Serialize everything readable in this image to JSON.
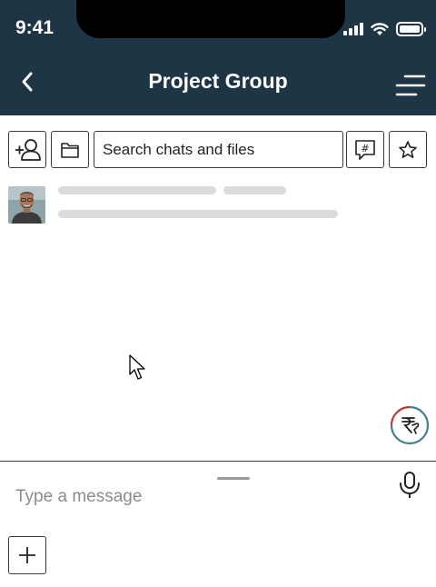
{
  "status_bar": {
    "time": "9:41"
  },
  "header": {
    "title": "Project Group"
  },
  "toolbar": {
    "search_placeholder": "Search chats and files",
    "icons": [
      "add-user-icon",
      "folder-icon",
      "hashtag-chat-icon",
      "star-icon"
    ]
  },
  "composer": {
    "placeholder": "Type a message"
  },
  "colors": {
    "header_bg": "#1e3545",
    "skeleton": "#dadbdd",
    "fab_ring_red": "#c0392b",
    "fab_ring_teal": "#3f7f8f"
  }
}
